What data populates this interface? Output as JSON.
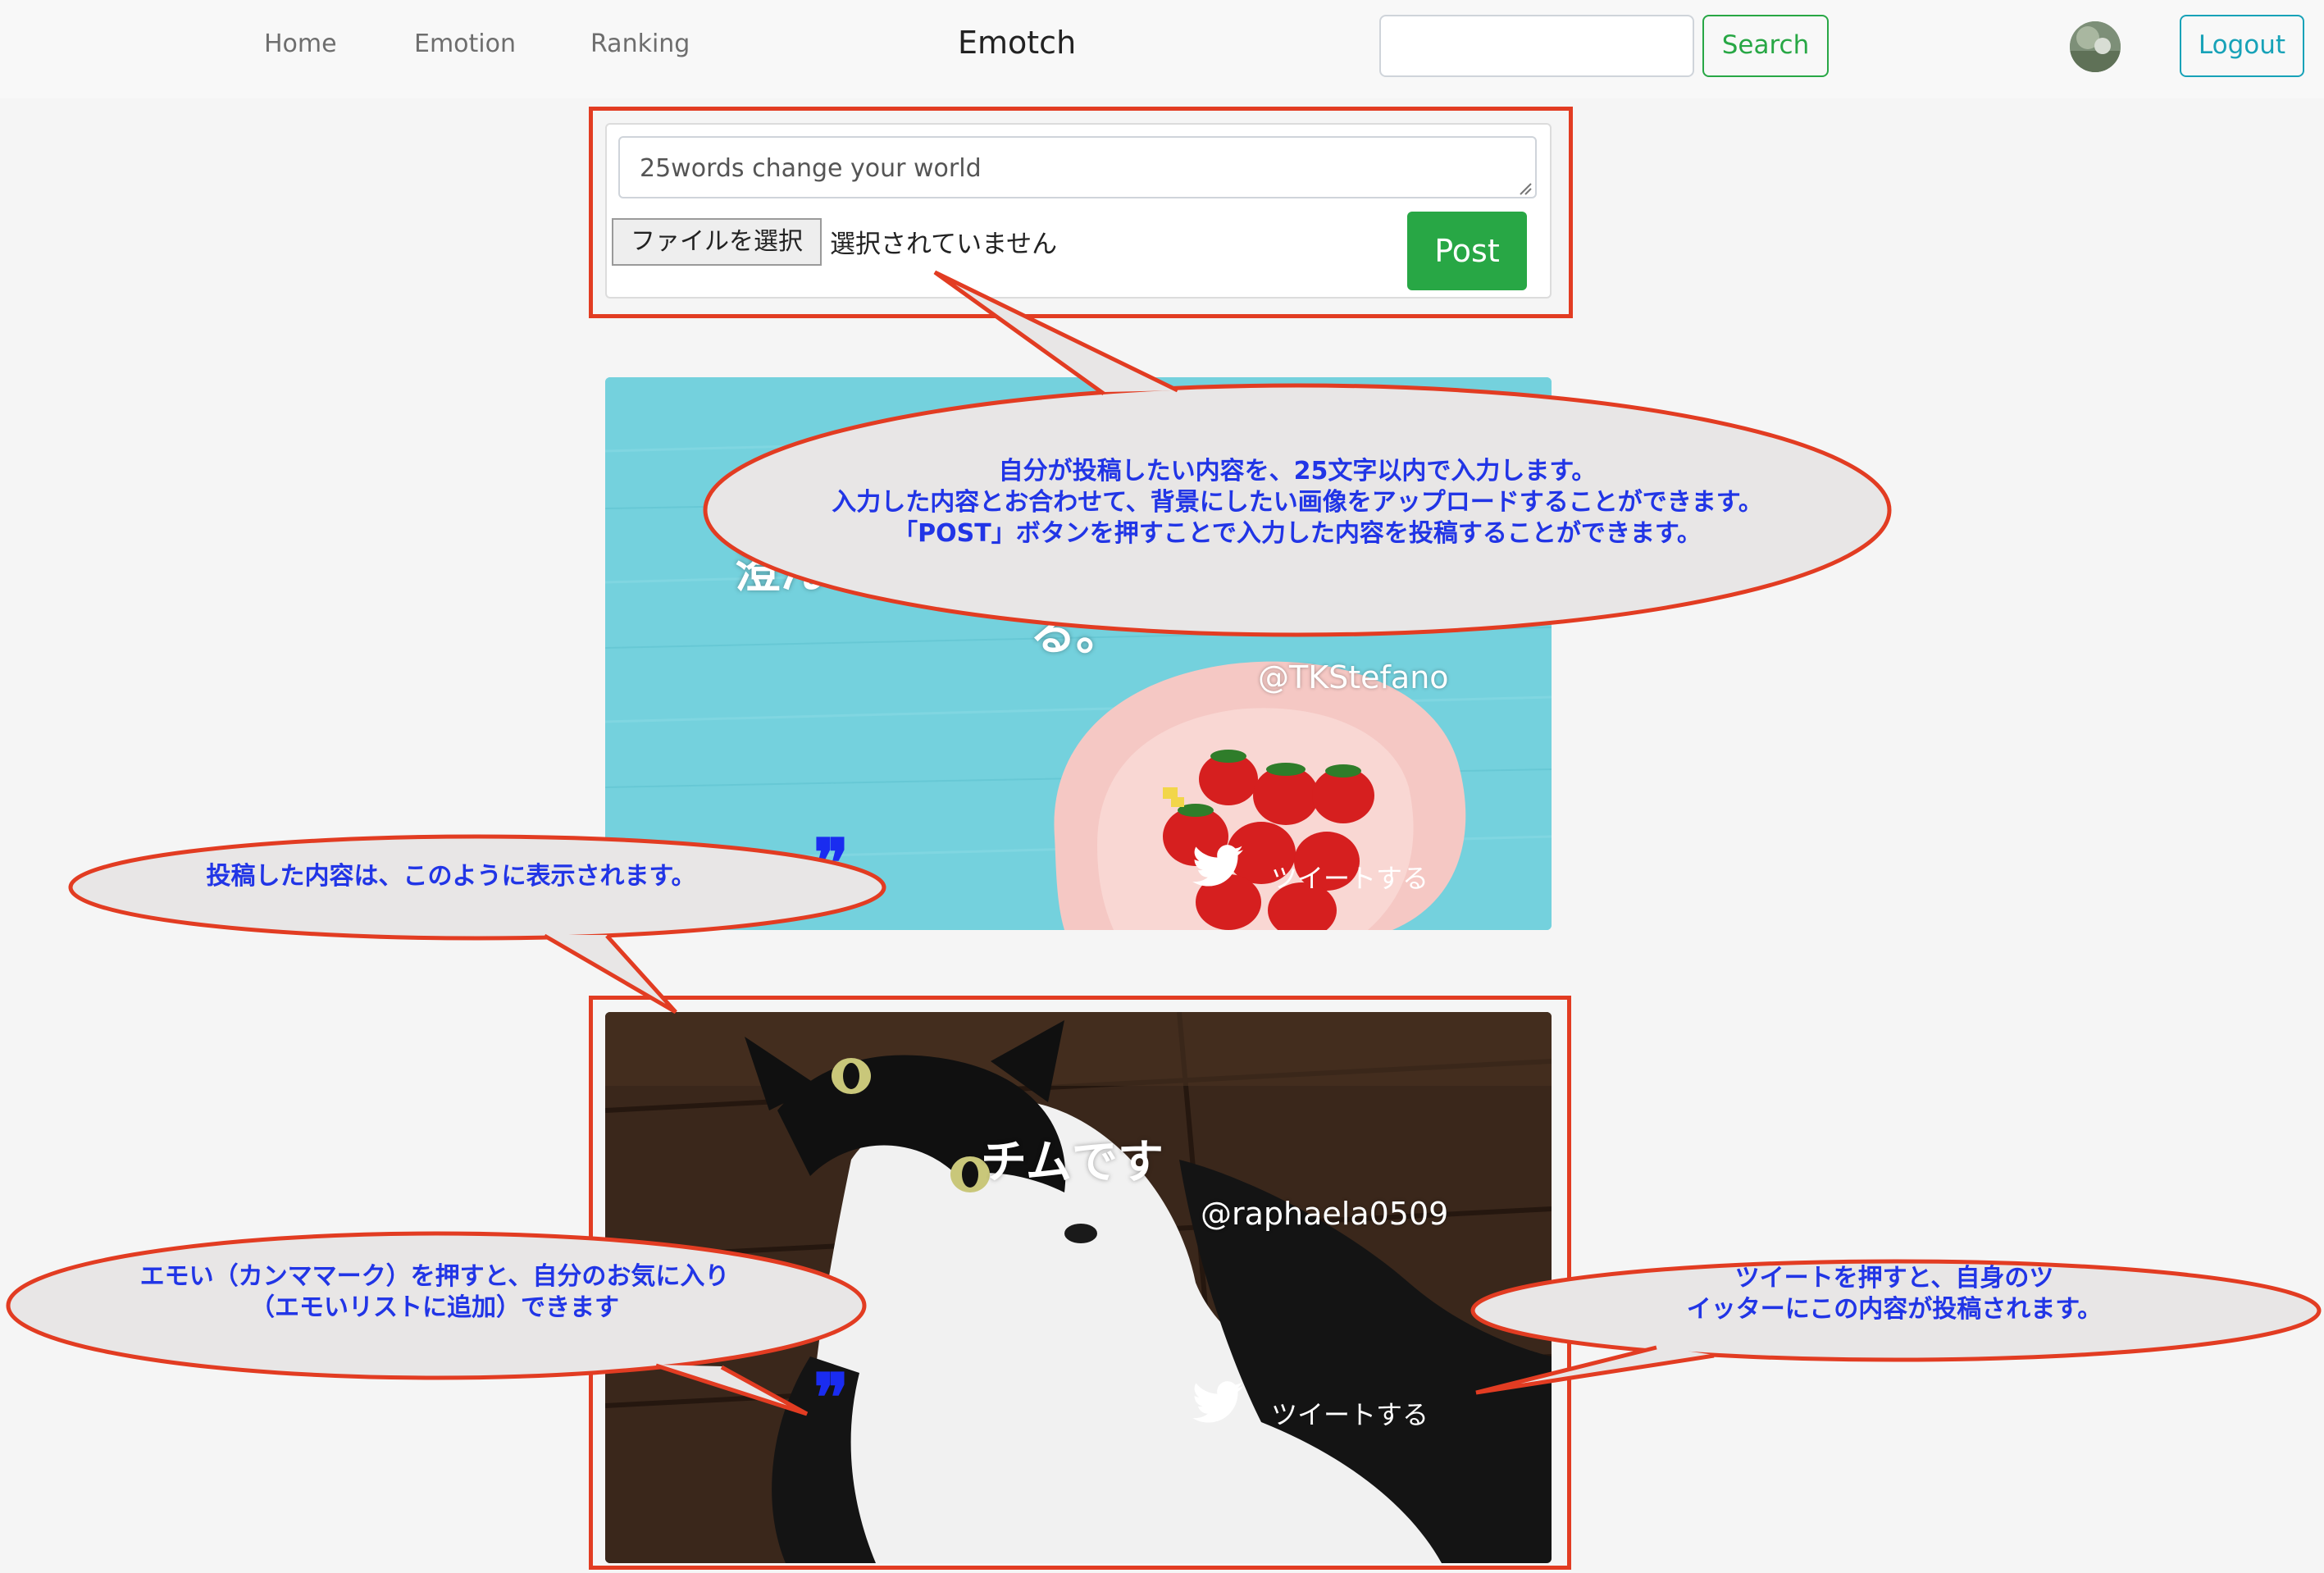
{
  "nav": {
    "home": "Home",
    "emotion": "Emotion",
    "ranking": "Ranking",
    "brand": "Emotch",
    "search_button": "Search",
    "logout_button": "Logout"
  },
  "post_form": {
    "placeholder": "25words change your world",
    "file_button": "ファイルを選択",
    "file_status": "選択されていません",
    "post_button": "Post"
  },
  "posts": [
    {
      "text_left": "澄ん",
      "text_right": "る。",
      "user": "@TKStefano",
      "tweet_label": "ツイートする",
      "emoi_mark": "❞"
    },
    {
      "text": "チムです",
      "user": "@raphaela0509",
      "tweet_label": "ツイートする",
      "emoi_mark": "❞"
    }
  ],
  "callouts": {
    "post_form": [
      "自分が投稿したい内容を、25文字以内で入力します。",
      "入力した内容とお合わせて、背景にしたい画像をアップロードすることができます。",
      "「POST」ボタンを押すことで入力した内容を投稿することができます。"
    ],
    "display": [
      "投稿した内容は、このように表示されます。"
    ],
    "emoi": [
      "エモい（カンママーク）を押すと、自分のお気に入り",
      "（エモいリストに追加）できます"
    ],
    "tweet": [
      "ツイートを押すと、自身のツ",
      "イッターにこの内容が投稿されます。"
    ]
  },
  "colors": {
    "annotation_red": "#e23c22",
    "annotation_text": "#2135e6",
    "search_green": "#28a745",
    "logout_teal": "#17a2b8",
    "emoi_blue": "#1a2cf0"
  }
}
